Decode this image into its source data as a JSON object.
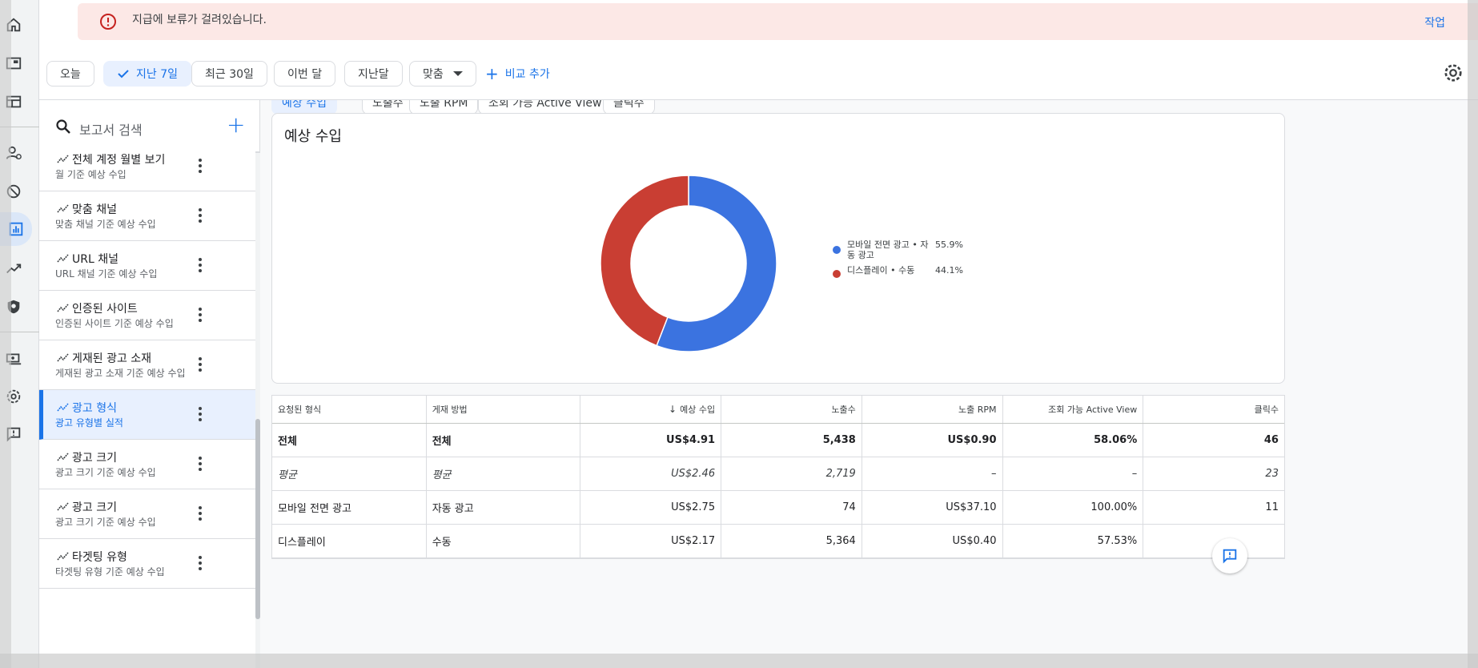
{
  "alert": {
    "message": "지급에 보류가 걸려있습니다.",
    "action": "작업"
  },
  "date_filters": [
    {
      "label": "오늘",
      "selected": false
    },
    {
      "label": "지난 7일",
      "selected": true
    },
    {
      "label": "최근 30일",
      "selected": false
    },
    {
      "label": "이번 달",
      "selected": false
    },
    {
      "label": "지난달",
      "selected": false
    },
    {
      "label": "맞춤",
      "selected": false
    }
  ],
  "add_compare": "비교 추가",
  "search": {
    "placeholder": "보고서 검색"
  },
  "reports": [
    {
      "title": "전체 계정 월별 보기",
      "subtitle": "월 기준 예상 수입",
      "selected": false
    },
    {
      "title": "맞춤 채널",
      "subtitle": "맞춤 채널 기준 예상 수입",
      "selected": false
    },
    {
      "title": "URL 채널",
      "subtitle": "URL 채널 기준 예상 수입",
      "selected": false
    },
    {
      "title": "인증된 사이트",
      "subtitle": "인증된 사이트 기준 예상 수입",
      "selected": false
    },
    {
      "title": "게재된 광고 소재",
      "subtitle": "게재된 광고 소재 기준 예상 수입",
      "selected": false
    },
    {
      "title": "광고 형식",
      "subtitle": "광고 유형별 실적",
      "selected": true
    },
    {
      "title": "광고 크기",
      "subtitle": "광고 크기 기준 예상 수입",
      "selected": false
    },
    {
      "title": "광고 크기",
      "subtitle": "광고 크기 기준 예상 수입",
      "selected": false
    },
    {
      "title": "타겟팅 유형",
      "subtitle": "타겟팅 유형 기준 예상 수입",
      "selected": false
    }
  ],
  "metric_chips": [
    {
      "label": "예상 수입",
      "selected": true
    },
    {
      "label": "노출수",
      "selected": false
    },
    {
      "label": "노출 RPM",
      "selected": false
    },
    {
      "label": "조회 가능 Active View",
      "selected": false
    },
    {
      "label": "클릭수",
      "selected": false
    }
  ],
  "chart": {
    "title": "예상 수입"
  },
  "chart_data": {
    "type": "pie",
    "title": "예상 수입",
    "slices": [
      {
        "label": "모바일 전면 광고 • 자동 광고",
        "value": 55.9,
        "display": "55.9%",
        "color": "#3b73e0"
      },
      {
        "label": "디스플레이 • 수동",
        "value": 44.1,
        "display": "44.1%",
        "color": "#c93e33"
      }
    ],
    "legend_position": "right"
  },
  "table": {
    "headers": [
      "요청된 형식",
      "게재 방법",
      "예상 수입",
      "노출수",
      "노출 RPM",
      "조회 가능 Active View",
      "클릭수"
    ],
    "sort_arrow": "↓",
    "rows": [
      {
        "kind": "total",
        "cells": [
          "전체",
          "전체",
          "US$4.91",
          "5,438",
          "US$0.90",
          "58.06%",
          "46"
        ]
      },
      {
        "kind": "avg",
        "cells": [
          "평균",
          "평균",
          "US$2.46",
          "2,719",
          "–",
          "–",
          "23"
        ]
      },
      {
        "kind": "row",
        "cells": [
          "모바일 전면 광고",
          "자동 광고",
          "US$2.75",
          "74",
          "US$37.10",
          "100.00%",
          "11"
        ]
      },
      {
        "kind": "row",
        "cells": [
          "디스플레이",
          "수동",
          "US$2.17",
          "5,364",
          "US$0.40",
          "57.53%",
          ""
        ]
      }
    ]
  }
}
